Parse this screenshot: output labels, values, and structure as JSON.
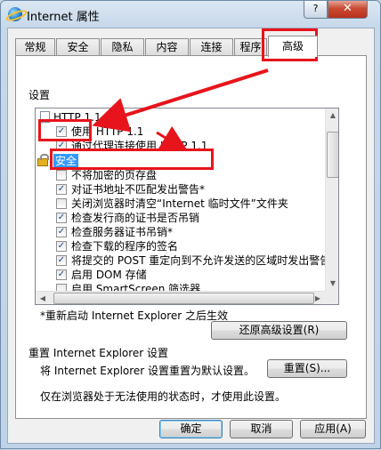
{
  "window": {
    "title": "Internet 属性",
    "help_label": "?",
    "close_label": "✕"
  },
  "tabs": [
    "常规",
    "安全",
    "隐私",
    "内容",
    "连接",
    "程序",
    "高级"
  ],
  "active_tab": "高级",
  "settings": {
    "group_label": "设置",
    "items": [
      {
        "type": "header",
        "icon": "page-icon",
        "label": "HTTP 1.1 设置"
      },
      {
        "type": "checkbox",
        "checked": true,
        "label": "使用 HTTP 1.1"
      },
      {
        "type": "checkbox",
        "checked": true,
        "label": "通过代理连接使用 HTTP 1.1"
      },
      {
        "type": "header",
        "icon": "lock-icon",
        "label": "安全",
        "selected": true
      },
      {
        "type": "checkbox",
        "checked": false,
        "label": "不将加密的页存盘"
      },
      {
        "type": "checkbox",
        "checked": true,
        "label": "对证书地址不匹配发出警告*"
      },
      {
        "type": "checkbox",
        "checked": false,
        "label": "关闭浏览器时清空“Internet 临时文件”文件夹"
      },
      {
        "type": "checkbox",
        "checked": true,
        "label": "检查发行商的证书是否吊销"
      },
      {
        "type": "checkbox",
        "checked": true,
        "label": "检查服务器证书吊销*"
      },
      {
        "type": "checkbox",
        "checked": true,
        "label": "检查下载的程序的签名"
      },
      {
        "type": "checkbox",
        "checked": true,
        "label": "将提交的 POST 重定向到不允许发送的区域时发出警告"
      },
      {
        "type": "checkbox",
        "checked": true,
        "label": "启用 DOM 存储"
      },
      {
        "type": "checkbox",
        "checked": false,
        "label": "启用 SmartScreen 筛选器"
      }
    ]
  },
  "restart_note": "*重新启动 Internet Explorer 之后生效",
  "restore_button": "还原高级设置(R)",
  "reset_section": {
    "title": "重置 Internet Explorer 设置",
    "description": "将 Internet Explorer 设置重置为默认设置。",
    "reset_button": "重置(S)...",
    "note": "仅在浏览器处于无法使用的状态时，才使用此设置。"
  },
  "footer": {
    "ok": "确定",
    "cancel": "取消",
    "apply": "应用(A)"
  },
  "colors": {
    "annotation": "#e8141b",
    "selection": "#3399ff",
    "close_button": "#c94a32"
  }
}
